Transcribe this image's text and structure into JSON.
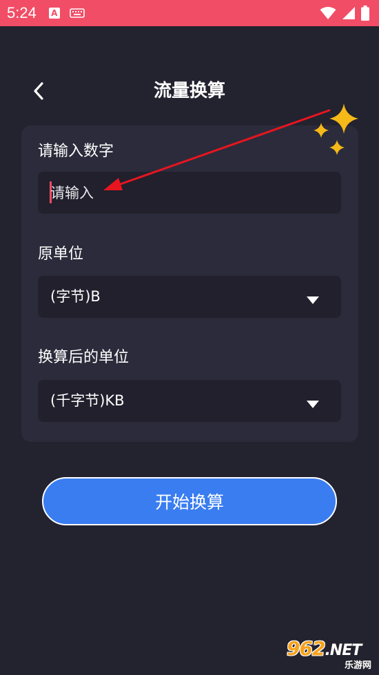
{
  "status_bar": {
    "time": "5:24",
    "notification_letter": "A",
    "icons": [
      "keyboard-icon",
      "wifi-icon",
      "signal-icon",
      "battery-icon"
    ]
  },
  "header": {
    "title": "流量换算",
    "back_icon": "chevron-left-icon"
  },
  "form": {
    "number_label": "请输入数字",
    "number_input": {
      "value": "",
      "placeholder": "请输入"
    },
    "source_unit_label": "原单位",
    "source_unit_selected": "(字节)B",
    "target_unit_label": "换算后的单位",
    "target_unit_selected": "(千字节)KB"
  },
  "actions": {
    "convert_label": "开始换算"
  },
  "watermark": {
    "top": "962",
    "net": ".NET",
    "bottom": "乐游网"
  },
  "colors": {
    "background": "#23222f",
    "card": "#2c2b3b",
    "field": "#21202c",
    "status_bar": "#f24d66",
    "primary": "#3a7df0",
    "annotation": "#e8151f",
    "sparkle": "#f5b918"
  }
}
